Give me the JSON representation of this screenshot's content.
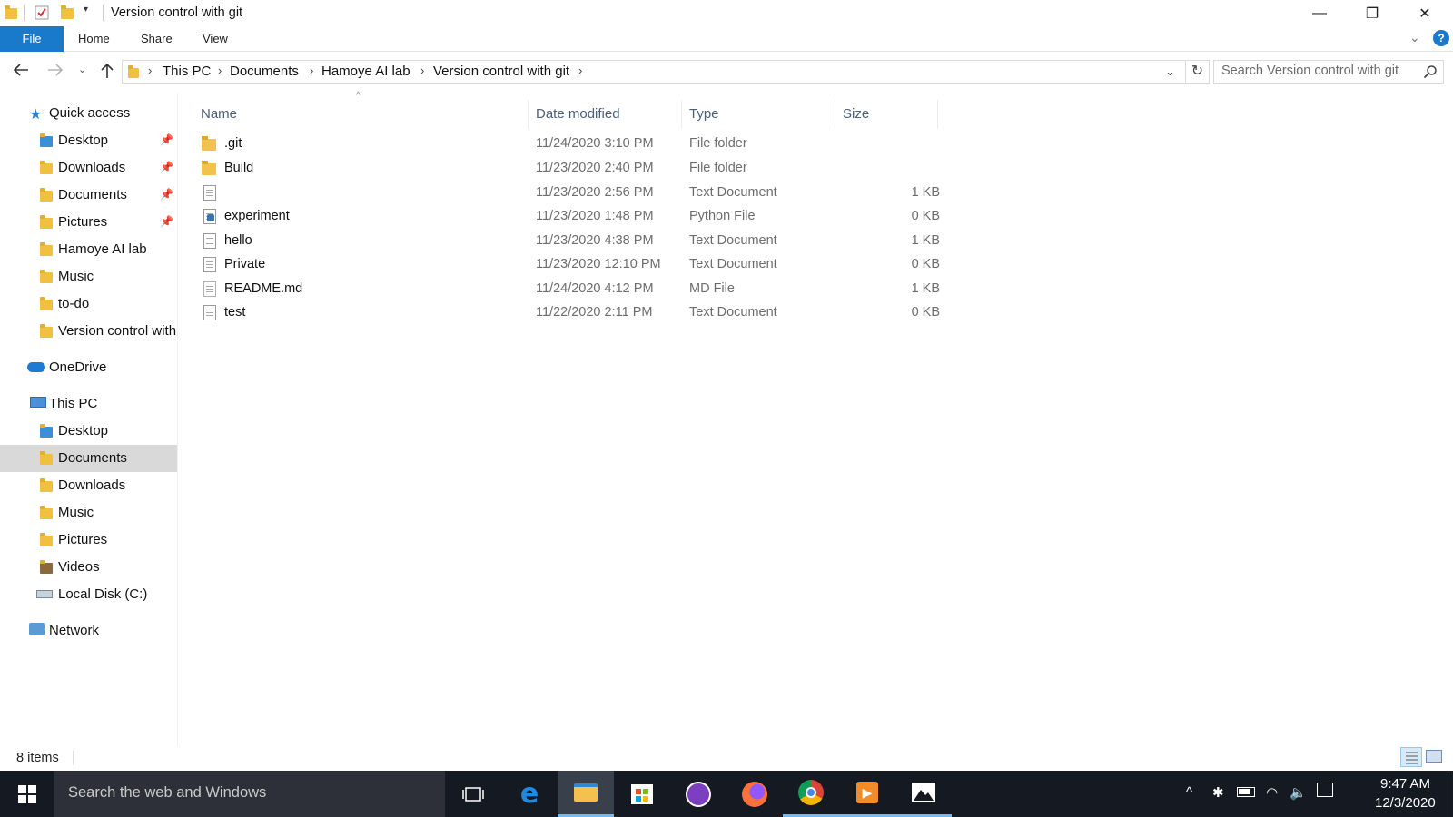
{
  "window": {
    "title": "Version control with git",
    "minimize_glyph": "—",
    "restore_glyph": "❐",
    "close_glyph": "✕"
  },
  "ribbon": {
    "tabs": [
      "File",
      "Home",
      "Share",
      "View"
    ],
    "help_glyph": "?"
  },
  "address": {
    "crumbs": [
      "This PC",
      "Documents",
      "Hamoye AI lab",
      "Version control with git"
    ]
  },
  "search": {
    "placeholder": "Search Version control with git"
  },
  "sidebar": {
    "items": [
      {
        "label": "Quick access",
        "icon": "star-icon"
      },
      {
        "label": "Desktop",
        "icon": "desktop-folder-icon",
        "pinned": true
      },
      {
        "label": "Downloads",
        "icon": "downloads-folder-icon",
        "pinned": true
      },
      {
        "label": "Documents",
        "icon": "documents-folder-icon",
        "pinned": true
      },
      {
        "label": "Pictures",
        "icon": "pictures-folder-icon",
        "pinned": true
      },
      {
        "label": "Hamoye AI lab",
        "icon": "folder-icon"
      },
      {
        "label": "Music",
        "icon": "music-folder-icon"
      },
      {
        "label": "to-do",
        "icon": "folder-icon"
      },
      {
        "label": "Version control with",
        "icon": "folder-icon"
      },
      {
        "label": "OneDrive",
        "icon": "cloud-icon"
      },
      {
        "label": "This PC",
        "icon": "computer-icon"
      },
      {
        "label": "Desktop",
        "icon": "desktop-folder-icon"
      },
      {
        "label": "Documents",
        "icon": "documents-folder-icon",
        "selected": true
      },
      {
        "label": "Downloads",
        "icon": "downloads-folder-icon"
      },
      {
        "label": "Music",
        "icon": "music-folder-icon"
      },
      {
        "label": "Pictures",
        "icon": "pictures-folder-icon"
      },
      {
        "label": "Videos",
        "icon": "videos-folder-icon"
      },
      {
        "label": "Local Disk (C:)",
        "icon": "drive-icon"
      },
      {
        "label": "Network",
        "icon": "network-icon"
      }
    ]
  },
  "columns": [
    "Name",
    "Date modified",
    "Type",
    "Size"
  ],
  "files": [
    {
      "name": ".git",
      "date": "11/24/2020 3:10 PM",
      "type": "File folder",
      "size": "",
      "icon": "folder-icon"
    },
    {
      "name": "Build",
      "date": "11/23/2020 2:40 PM",
      "type": "File folder",
      "size": "",
      "icon": "folder-icon"
    },
    {
      "name": "",
      "date": "11/23/2020 2:56 PM",
      "type": "Text Document",
      "size": "1 KB",
      "icon": "text-file-icon"
    },
    {
      "name": "experiment",
      "date": "11/23/2020 1:48 PM",
      "type": "Python File",
      "size": "0 KB",
      "icon": "python-file-icon"
    },
    {
      "name": "hello",
      "date": "11/23/2020 4:38 PM",
      "type": "Text Document",
      "size": "1 KB",
      "icon": "text-file-icon"
    },
    {
      "name": "Private",
      "date": "11/23/2020 12:10 PM",
      "type": "Text Document",
      "size": "0 KB",
      "icon": "text-file-icon"
    },
    {
      "name": "README.md",
      "date": "11/24/2020 4:12 PM",
      "type": "MD File",
      "size": "1 KB",
      "icon": "blank-file-icon"
    },
    {
      "name": "test",
      "date": "11/22/2020 2:11 PM",
      "type": "Text Document",
      "size": "0 KB",
      "icon": "text-file-icon"
    }
  ],
  "status": {
    "count": "8 items"
  },
  "taskbar": {
    "search_text": "Search the web and Windows",
    "time": "9:47 AM",
    "date": "12/3/2020"
  },
  "colors": {
    "accent": "#1979ca",
    "taskbar": "#151a22",
    "selected": "#d9d9d9",
    "folder": "#f2c14e"
  }
}
